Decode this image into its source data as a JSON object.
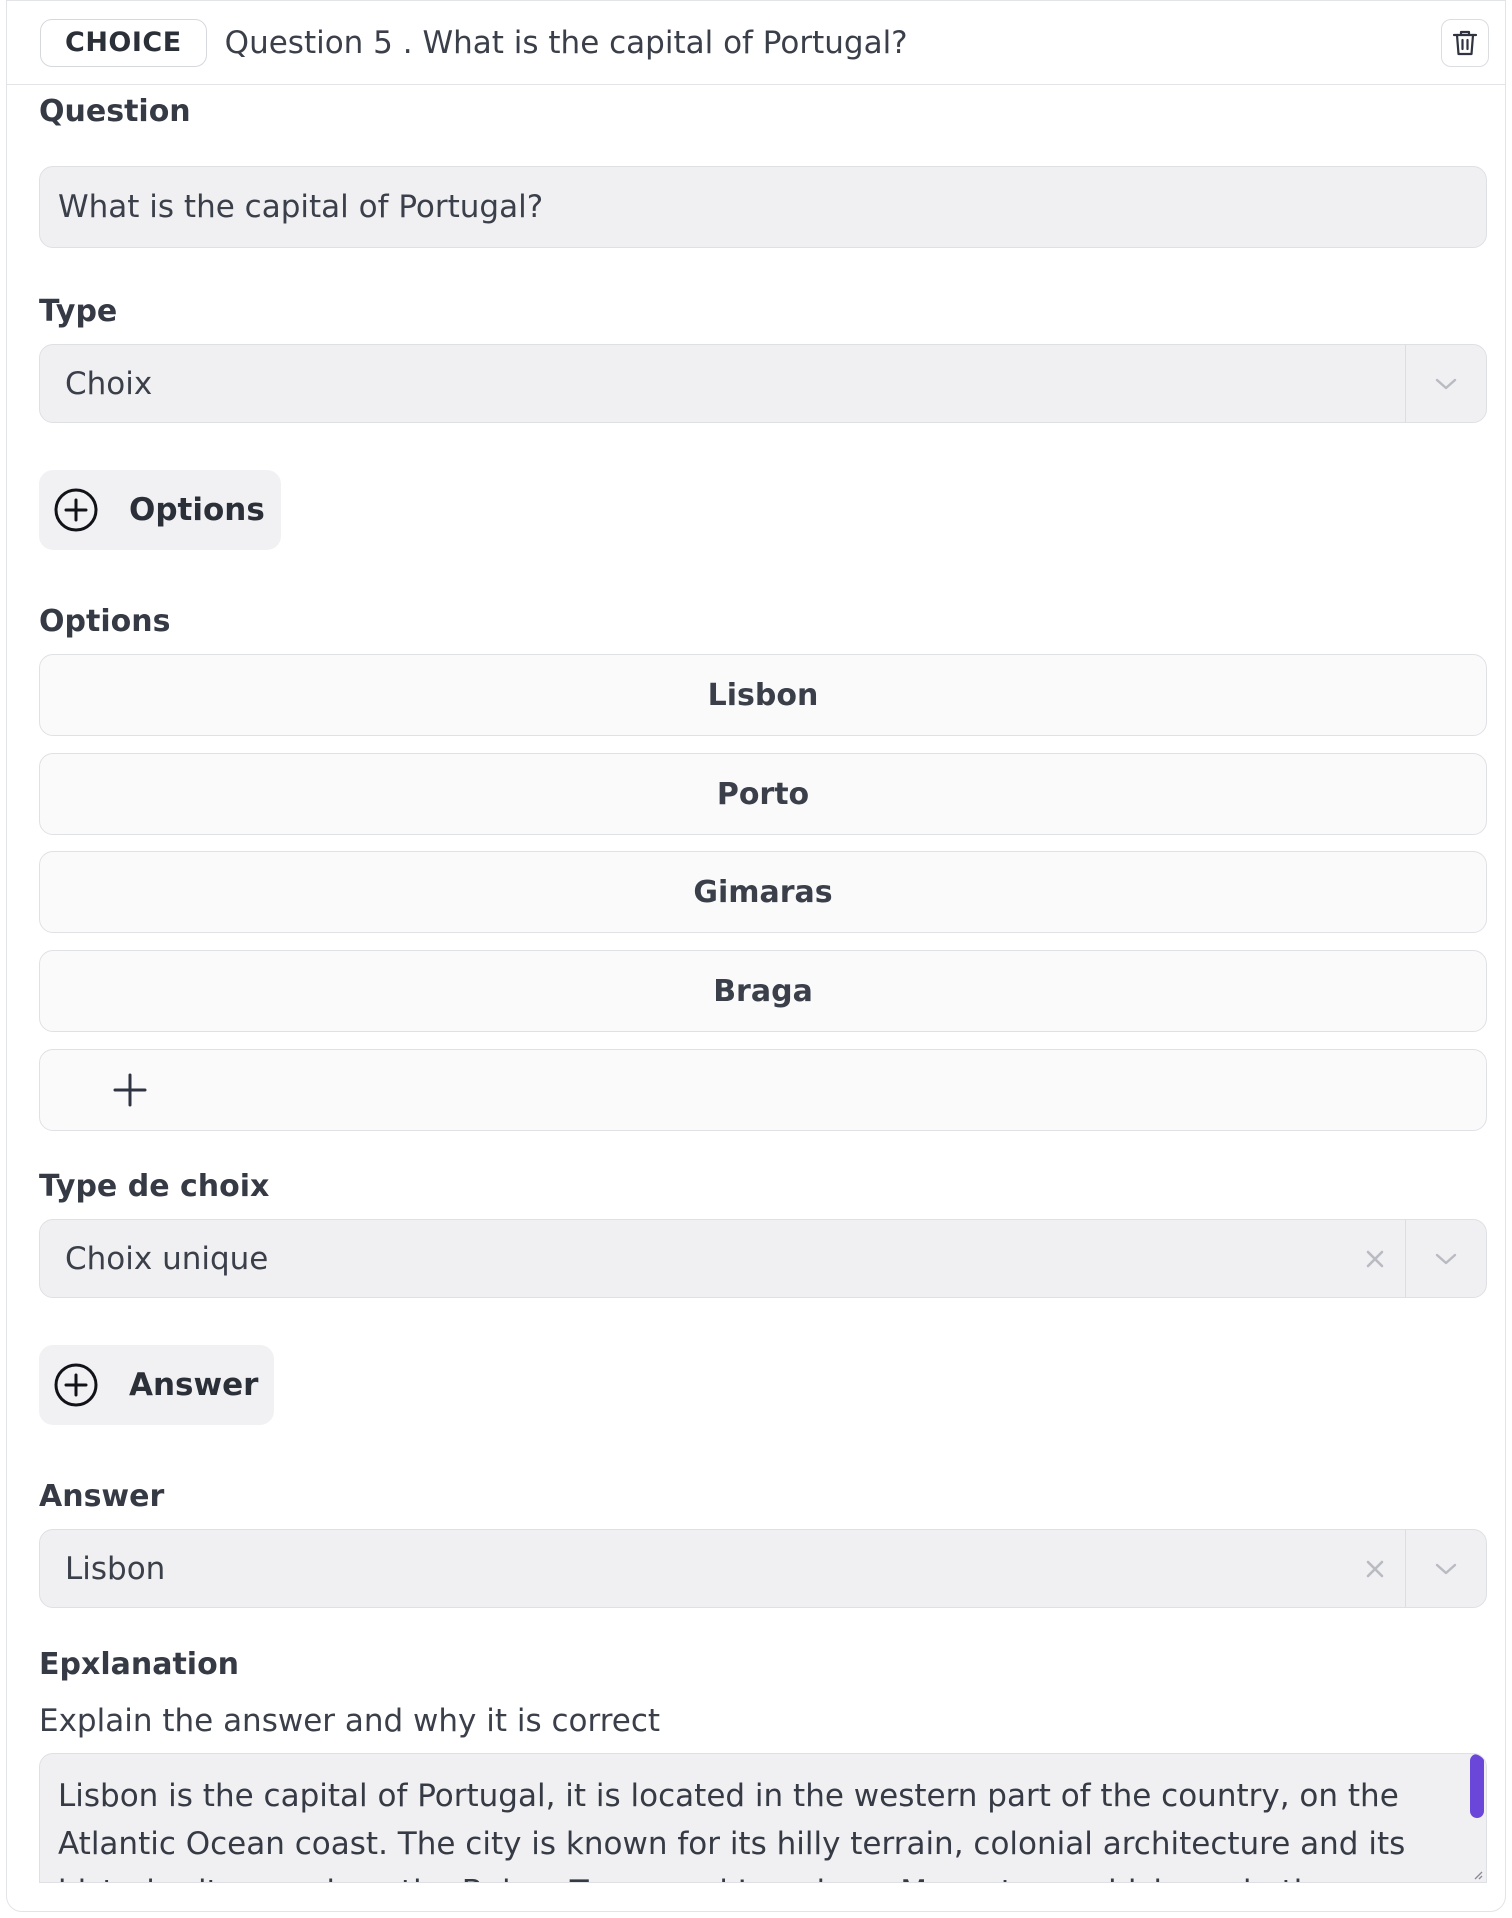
{
  "header": {
    "badge": "CHOICE",
    "title": "Question 5 . What is the capital of Portugal?"
  },
  "question": {
    "label": "Question",
    "value": "What is the capital of Portugal?"
  },
  "type": {
    "label": "Type",
    "value": "Choix"
  },
  "options_button": {
    "label": "Options"
  },
  "options": {
    "label": "Options",
    "items": [
      "Lisbon",
      "Porto",
      "Gimaras",
      "Braga"
    ]
  },
  "choice_type": {
    "label": "Type de choix",
    "value": "Choix unique"
  },
  "answer_button": {
    "label": "Answer"
  },
  "answer": {
    "label": "Answer",
    "value": "Lisbon"
  },
  "explanation": {
    "label": "Epxlanation",
    "hint": "Explain the answer and why it is correct",
    "value": "Lisbon is the capital of Portugal, it is located in the western part of the country, on the Atlantic Ocean coast. The city is known for its hilly terrain, colonial architecture and its historic sites, such as the Belem Tower and Jeronimos Monastery, which are both famous for their unique style."
  },
  "colors": {
    "scrollbar": "#6a47d8",
    "field_bg": "#f0f0f2",
    "text": "#2f3440"
  }
}
